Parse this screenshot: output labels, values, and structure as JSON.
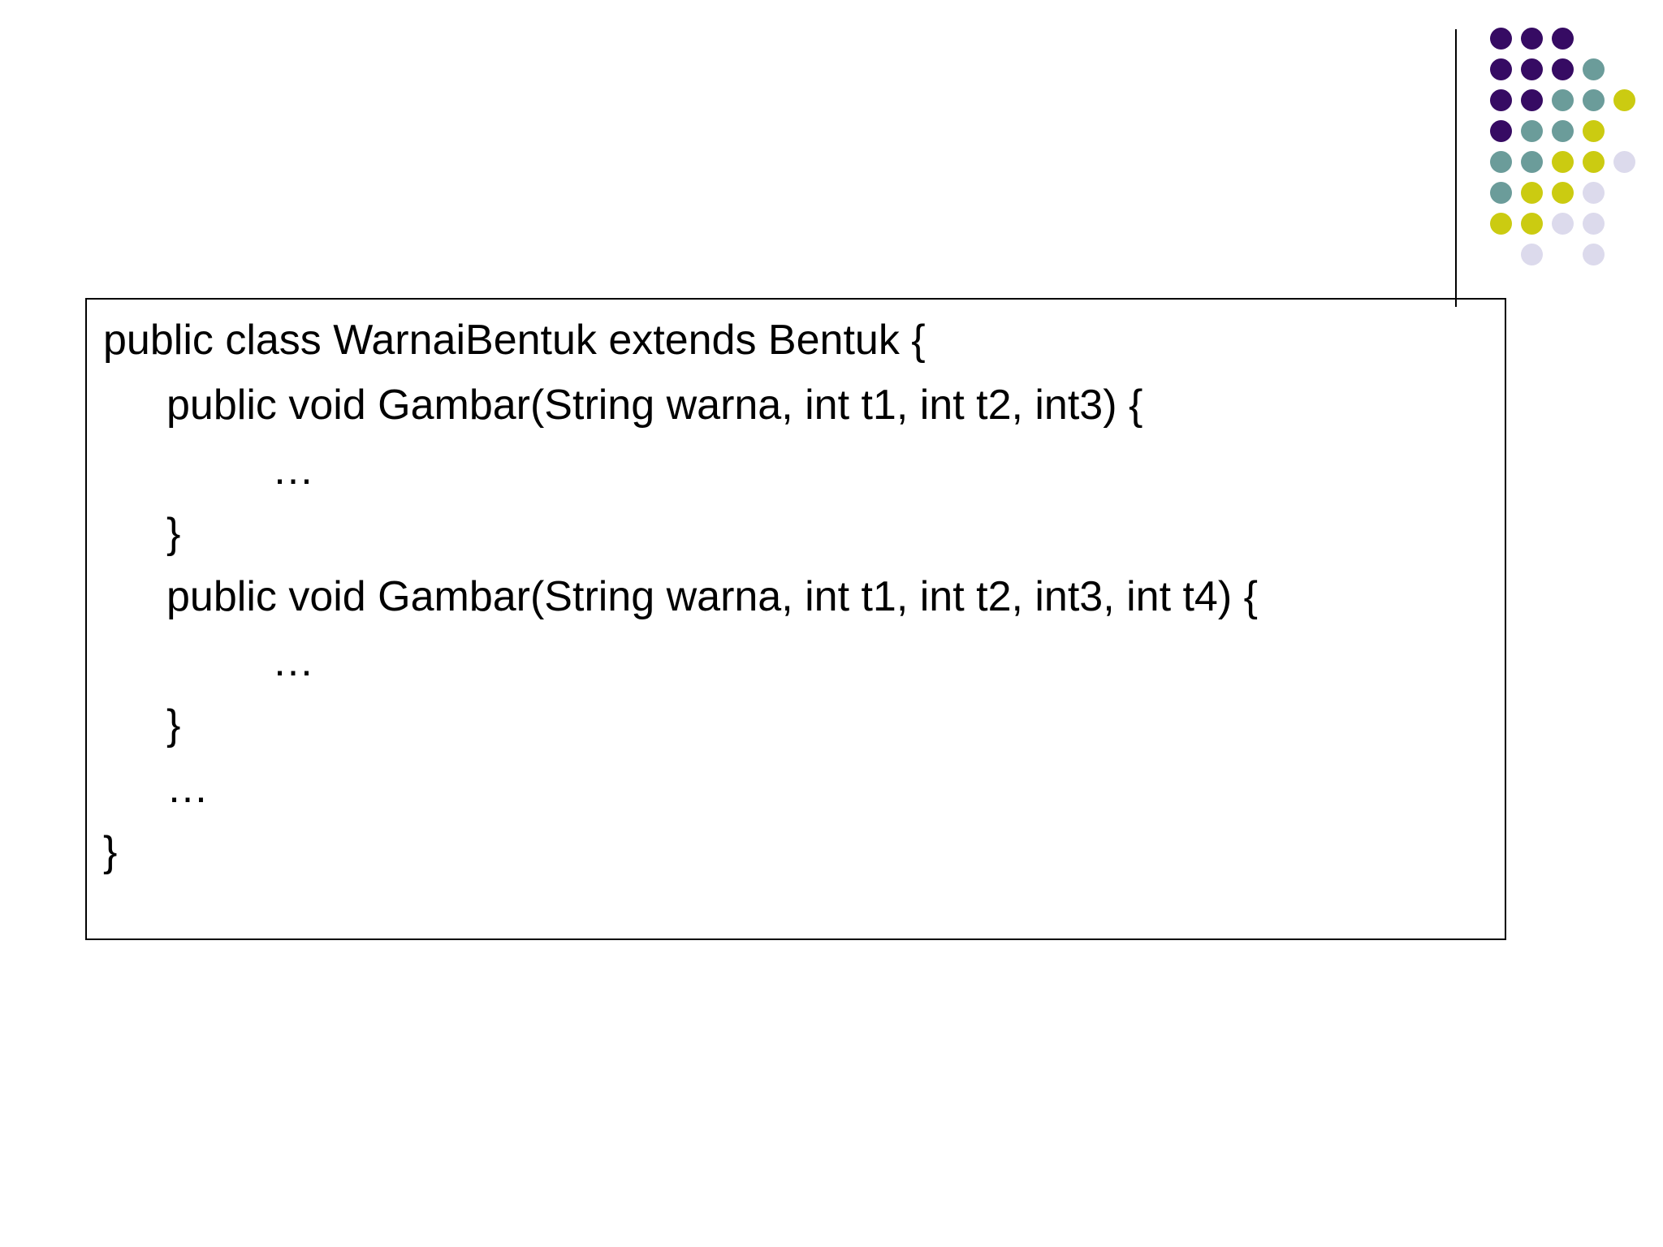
{
  "colors": {
    "purple": "#360b63",
    "teal": "#6b9c9a",
    "yellow": "#cbcb11",
    "lavender": "#dcdaec",
    "border": "#000000"
  },
  "code": {
    "lines": [
      "public class WarnaiBentuk extends Bentuk {",
      "public void Gambar(String warna, int t1, int t2, int3) {",
      "…",
      "}",
      "public void Gambar(String warna, int t1, int t2, int3, int t4) {",
      "…",
      "}",
      "…",
      "}"
    ]
  }
}
